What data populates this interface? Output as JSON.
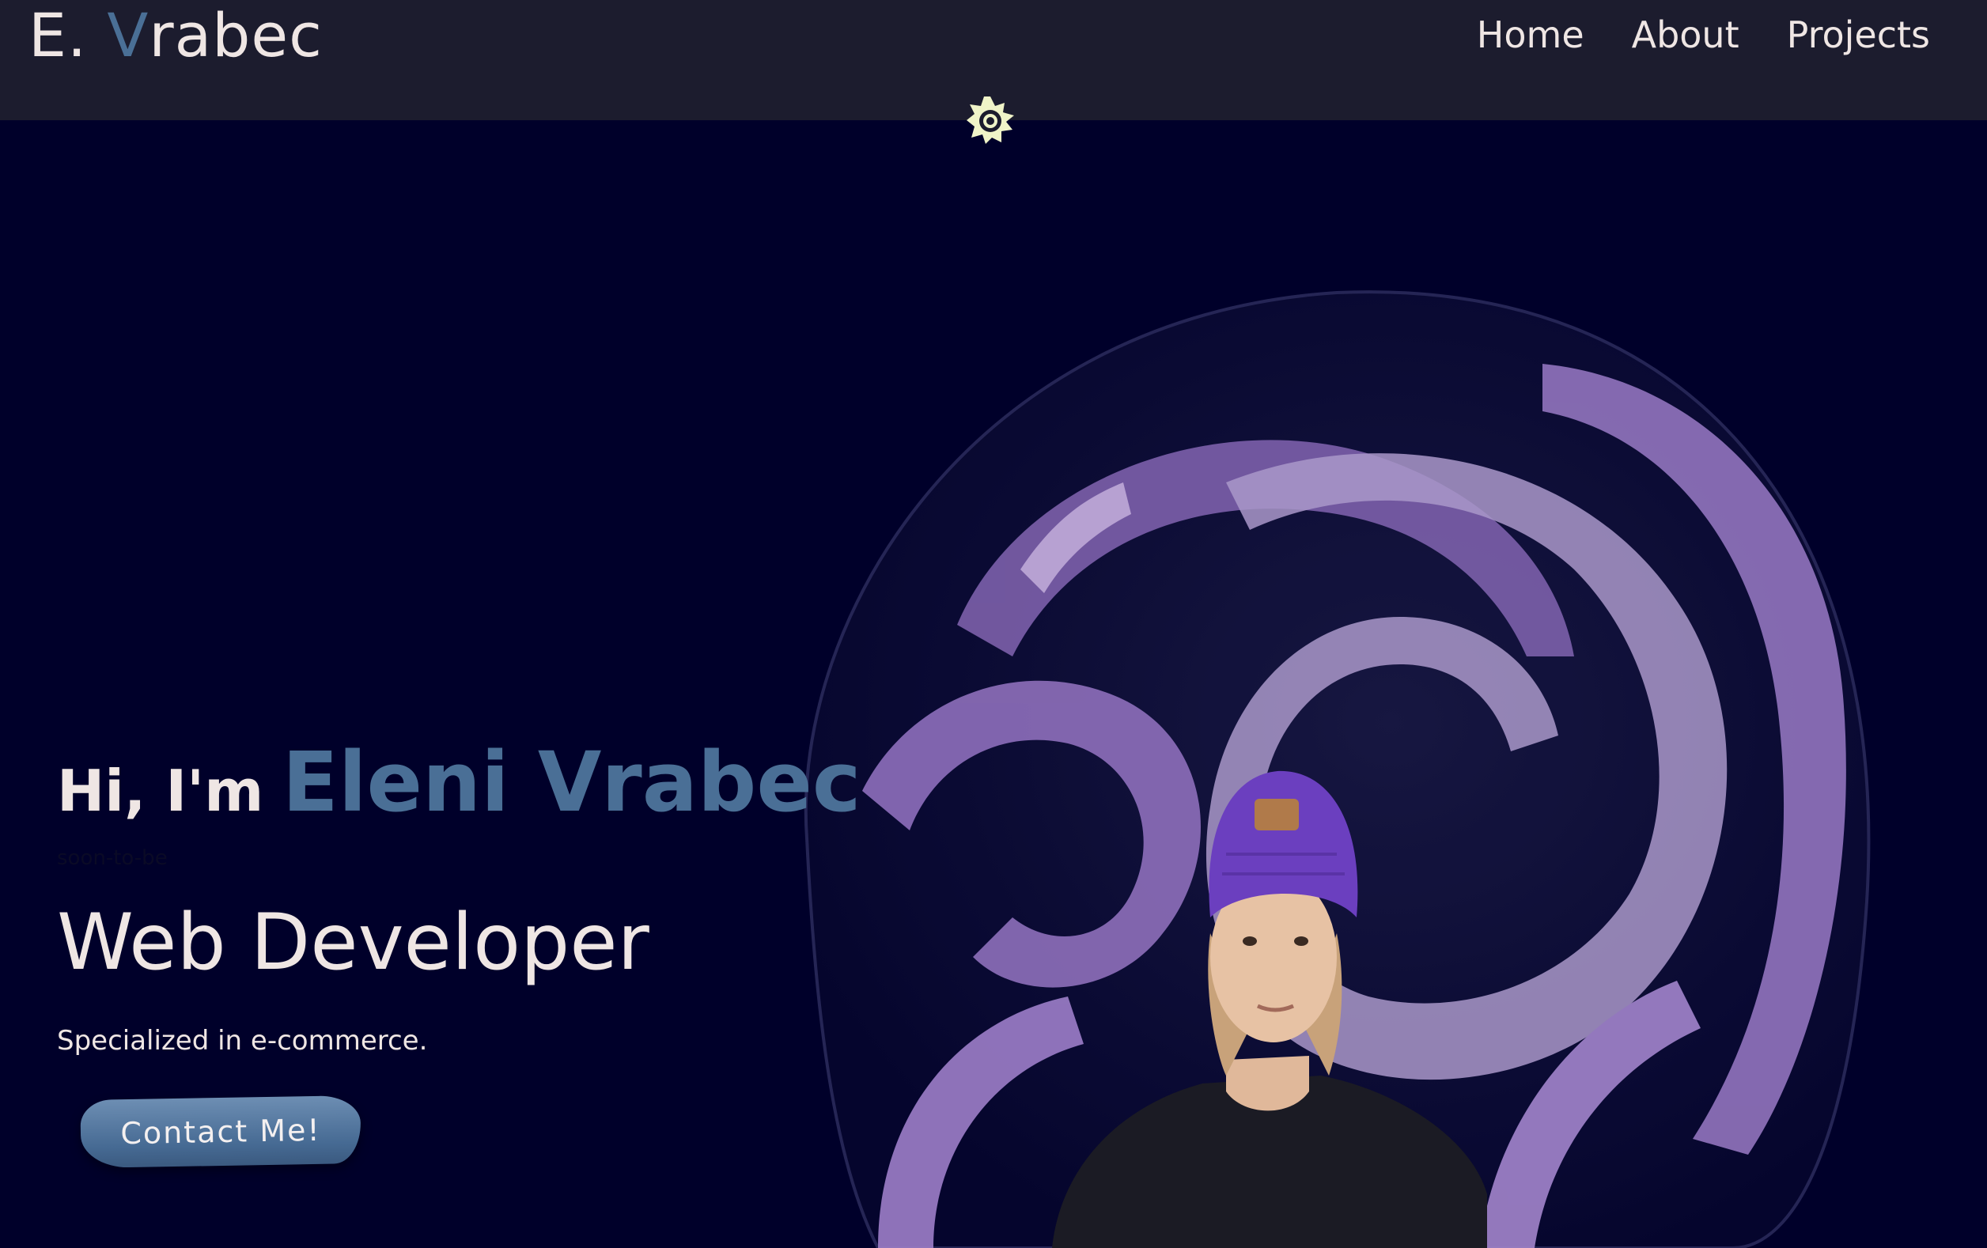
{
  "header": {
    "logo_prefix": "E. ",
    "logo_accent": "V",
    "logo_rest": "rabec",
    "nav": [
      {
        "label": "Home"
      },
      {
        "label": "About"
      },
      {
        "label": "Projects"
      }
    ],
    "theme_icon": "sun-icon"
  },
  "hero": {
    "greeting": "Hi, I'm",
    "name": "Eleni Vrabec",
    "qualifier": "soon-to-be",
    "role": "Web Developer",
    "subtitle": "Specialized in e-commerce.",
    "cta_label": "Contact Me!",
    "graphic": "portrait-with-purple-paint-swirl"
  },
  "colors": {
    "background": "#00002a",
    "header": "#1c1c2e",
    "accent": "#4a6f96",
    "text": "#efe6e4",
    "swirl": "#a58ac8",
    "sun": "#f0f4c8"
  }
}
